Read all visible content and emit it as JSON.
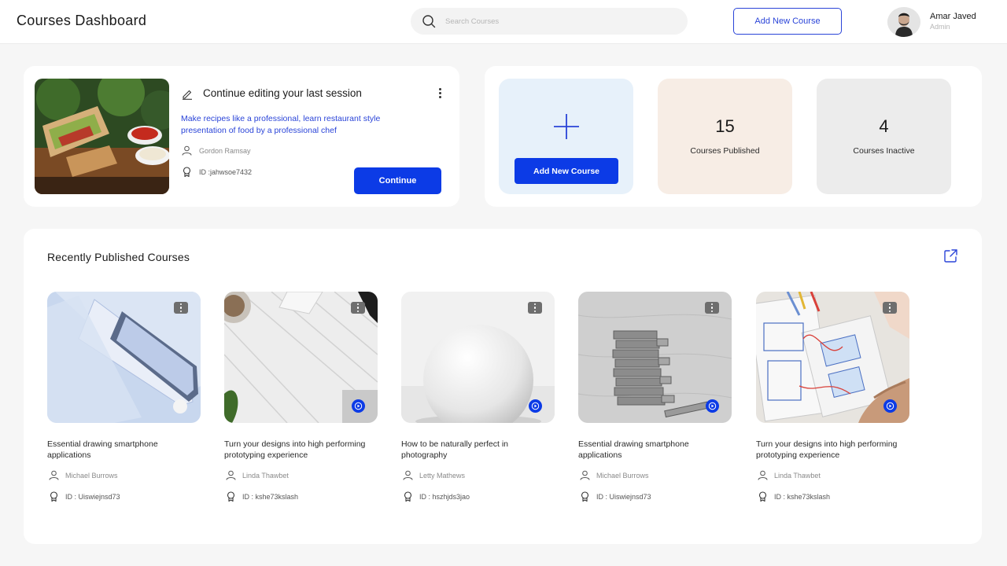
{
  "header": {
    "title": "Courses Dashboard",
    "search_placeholder": "Search Courses",
    "add_button": "Add New Course",
    "user": {
      "name": "Amar Javed",
      "role": "Admin"
    }
  },
  "session": {
    "title": "Continue editing your last session",
    "description": "Make recipes like a professional, learn restaurant style presentation of food by a professional chef",
    "author": "Gordon Ramsay",
    "id": "ID :jahwsoe7432",
    "continue_label": "Continue"
  },
  "stats": {
    "add_label": "Add New Course",
    "published": {
      "value": "15",
      "label": "Courses Published"
    },
    "inactive": {
      "value": "4",
      "label": "Courses Inactive"
    }
  },
  "recent": {
    "title": "Recently Published Courses",
    "courses": [
      {
        "title": "Essential drawing smartphone applications",
        "author": "Michael Burrows",
        "id": "ID : Uiswiejnsd73",
        "image": "glass-screen-protector"
      },
      {
        "title": "Turn your designs into high performing prototyping experience",
        "author": "Linda Thawbet",
        "id": "ID : kshe73kslash",
        "image": "white-wood-desk"
      },
      {
        "title": "How to be naturally perfect in photography",
        "author": "Letty Mathews",
        "id": "ID : hszhjds3jao",
        "image": "white-sphere"
      },
      {
        "title": "Essential drawing smartphone applications",
        "author": "Michael Burrows",
        "id": "ID : Uiswiejnsd73",
        "image": "wooden-block-tower"
      },
      {
        "title": "Turn your designs into high performing prototyping experience",
        "author": "Linda Thawbet",
        "id": "ID : kshe73kslash",
        "image": "wireframe-sketches"
      }
    ]
  },
  "colors": {
    "primary": "#0c3be6",
    "accent_text": "#2a44d8",
    "tile_add": "#e7f1fa",
    "tile_published": "#f7ede5",
    "tile_inactive": "#ececec"
  }
}
